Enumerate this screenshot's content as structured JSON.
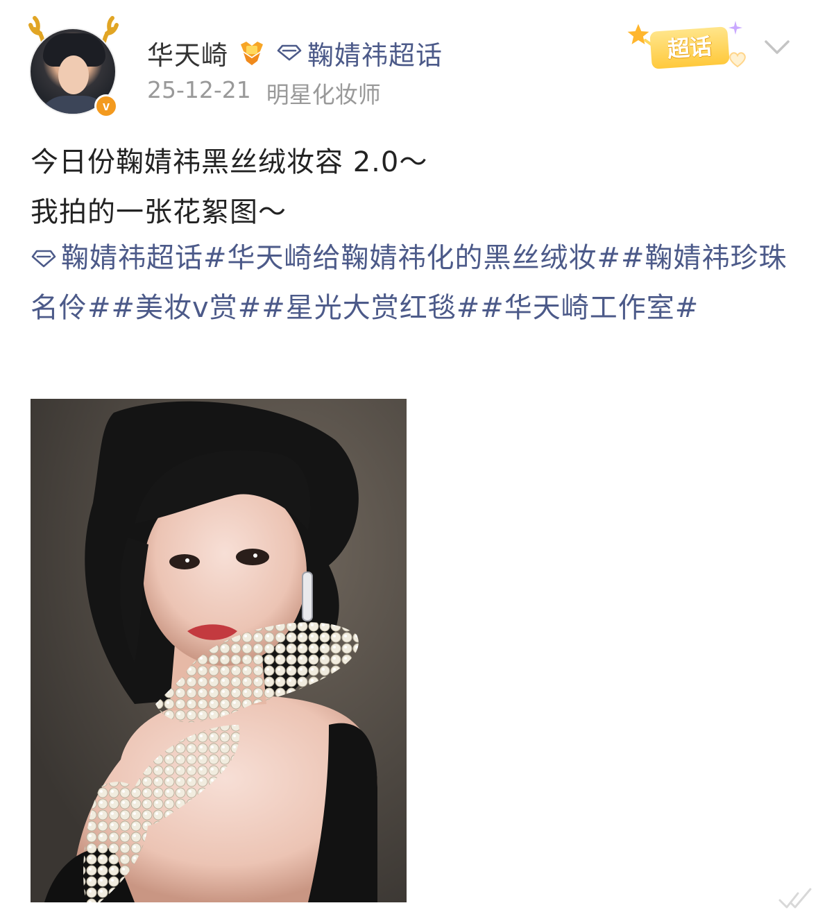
{
  "post": {
    "author": {
      "name": "华天崎",
      "verified_mark": "v",
      "avatar": "avatar-photo"
    },
    "topic": {
      "icon": "diamond-icon",
      "label": "鞠婧祎超话"
    },
    "date": "25-12-21",
    "source": "明星化妆师",
    "supertopic_tag": "超话",
    "text_lines": [
      "今日份鞠婧祎黑丝绒妆容 2.0～",
      "我拍的一张花絮图～"
    ],
    "hashtags": [
      "鞠婧祎超话",
      "#华天崎给鞠婧祎化的黑丝绒妆#",
      "#鞠婧祎珍珠名伶#",
      "#美妆v赏#",
      "#星光大赏红毯#",
      "#华天崎工作室#"
    ],
    "image": "portrait-photo"
  },
  "colors": {
    "link": "#4c5a89",
    "text": "#222222",
    "meta": "#999999",
    "verified": "#f39a1f",
    "supertopic": "#ffc93c"
  }
}
